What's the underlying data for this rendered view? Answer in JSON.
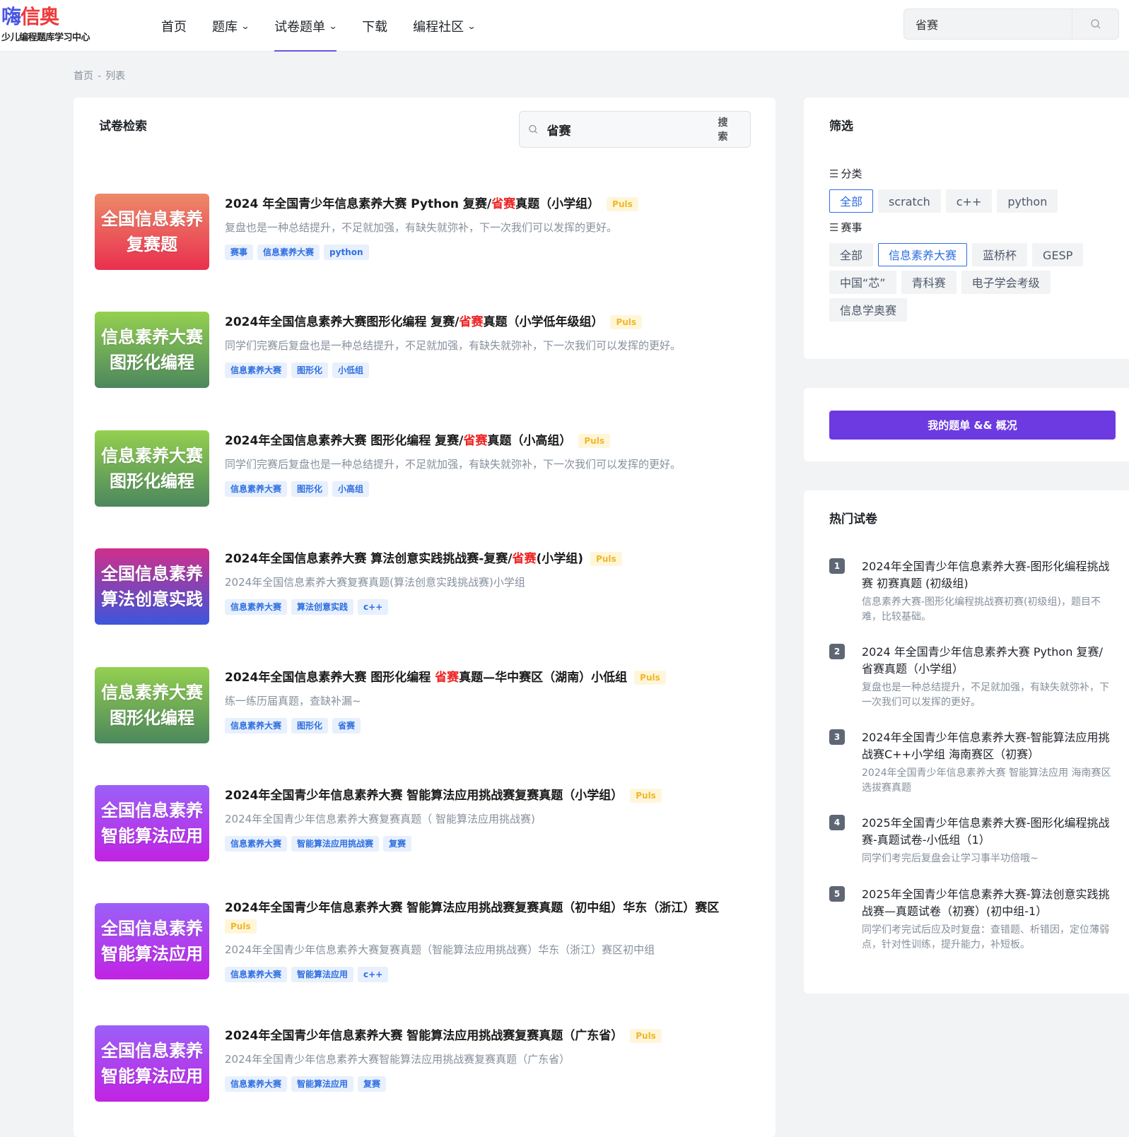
{
  "header": {
    "logo_main_a": "嗨",
    "logo_main_b": "信奥",
    "logo_sub": "少儿编程题库学习中心",
    "nav": [
      {
        "label": "首页"
      },
      {
        "label": "题库"
      },
      {
        "label": "试卷题单"
      },
      {
        "label": "下载"
      },
      {
        "label": "编程社区"
      }
    ],
    "search_value": "省赛"
  },
  "breadcrumb": {
    "home": "首页",
    "sep": "-",
    "current": "列表"
  },
  "main": {
    "title": "试卷检索",
    "search_value": "省赛",
    "search_button": "搜索",
    "items": [
      {
        "cover": [
          "全国信息素养",
          "复赛题"
        ],
        "title_pre": "2024 年全国青少年信息素养大赛 Python 复赛/",
        "title_hl": "省赛",
        "title_post": "真题（小学组）",
        "badge": "Puls",
        "desc": "复盘也是一种总结提升，不足就加强，有缺失就弥补，下一次我们可以发挥的更好。",
        "tags": [
          "赛事",
          "信息素养大赛",
          "python"
        ]
      },
      {
        "cover": [
          "信息素养大赛",
          "图形化编程"
        ],
        "title_pre": "2024年全国信息素养大赛图形化编程 复赛/",
        "title_hl": "省赛",
        "title_post": "真题（小学低年级组）",
        "badge": "Puls",
        "desc": "同学们完赛后复盘也是一种总结提升，不足就加强，有缺失就弥补，下一次我们可以发挥的更好。",
        "tags": [
          "信息素养大赛",
          "图形化",
          "小低组"
        ]
      },
      {
        "cover": [
          "信息素养大赛",
          "图形化编程"
        ],
        "title_pre": "2024年全国信息素养大赛 图形化编程 复赛/",
        "title_hl": "省赛",
        "title_post": "真题（小高组）",
        "badge": "Puls",
        "desc": "同学们完赛后复盘也是一种总结提升，不足就加强，有缺失就弥补，下一次我们可以发挥的更好。",
        "tags": [
          "信息素养大赛",
          "图形化",
          "小高组"
        ]
      },
      {
        "cover": [
          "全国信息素养",
          "算法创意实践"
        ],
        "title_pre": "2024年全国信息素养大赛 算法创意实践挑战赛-复赛/",
        "title_hl": "省赛",
        "title_post": "(小学组)",
        "badge": "Puls",
        "desc": "2024年全国信息素养大赛复赛真题(算法创意实践挑战赛)小学组",
        "tags": [
          "信息素养大赛",
          "算法创意实践",
          "c++"
        ]
      },
      {
        "cover": [
          "信息素养大赛",
          "图形化编程"
        ],
        "title_pre": "2024年全国信息素养大赛 图形化编程 ",
        "title_hl": "省赛",
        "title_post": "真题—华中赛区（湖南）小低组",
        "badge": "Puls",
        "desc": "练一练历届真题，查缺补漏~",
        "tags": [
          "信息素养大赛",
          "图形化",
          "省赛"
        ]
      },
      {
        "cover": [
          "全国信息素养",
          "智能算法应用"
        ],
        "title_pre": "2024年全国青少年信息素养大赛 智能算法应用挑战赛复赛真题（小学组）",
        "title_hl": "",
        "title_post": "",
        "badge": "Puls",
        "desc": "2024年全国青少年信息素养大赛复赛真题（ 智能算法应用挑战赛)",
        "tags": [
          "信息素养大赛",
          "智能算法应用挑战赛",
          "复赛"
        ]
      },
      {
        "cover": [
          "全国信息素养",
          "智能算法应用"
        ],
        "title_pre": "2024年全国青少年信息素养大赛 智能算法应用挑战赛复赛真题（初中组）华东（浙江）赛区",
        "title_hl": "",
        "title_post": "",
        "badge": "Puls",
        "desc": "2024年全国青少年信息素养大赛复赛真题（智能算法应用挑战赛）华东（浙江）赛区初中组",
        "tags": [
          "信息素养大赛",
          "智能算法应用",
          "c++"
        ]
      },
      {
        "cover": [
          "全国信息素养",
          "智能算法应用"
        ],
        "title_pre": "2024年全国青少年信息素养大赛 智能算法应用挑战赛复赛真题（广东省）",
        "title_hl": "",
        "title_post": "",
        "badge": "Puls",
        "desc": "2024年全国青少年信息素养大赛智能算法应用挑战赛复赛真题（广东省）",
        "tags": [
          "信息素养大赛",
          "智能算法应用",
          "复赛"
        ]
      }
    ]
  },
  "filter": {
    "title": "筛选",
    "category_label": "分类",
    "categories": [
      "全部",
      "scratch",
      "c++",
      "python"
    ],
    "category_active": "全部",
    "contest_label": "赛事",
    "contests": [
      "全部",
      "信息素养大赛",
      "蓝桥杯",
      "GESP",
      "中国“芯”",
      "青科赛",
      "电子学会考级",
      "信息学奥赛"
    ],
    "contest_active": "信息素养大赛"
  },
  "mylist": {
    "button": "我的题单 && 概况"
  },
  "hot": {
    "title": "热门试卷",
    "items": [
      {
        "rank": "1",
        "title": "2024年全国青少年信息素养大赛-图形化编程挑战赛 初赛真题 (初级组)",
        "desc": "信息素养大赛-图形化编程挑战赛初赛(初级组)，题目不难，比较基础。"
      },
      {
        "rank": "2",
        "title": "2024 年全国青少年信息素养大赛 Python 复赛/省赛真题（小学组）",
        "desc": "复盘也是一种总结提升，不足就加强，有缺失就弥补，下一次我们可以发挥的更好。"
      },
      {
        "rank": "3",
        "title": "2024年全国青少年信息素养大赛-智能算法应用挑战赛C++小学组 海南赛区（初赛）",
        "desc": "2024年全国青少年信息素养大赛 智能算法应用 海南赛区选拔赛真题"
      },
      {
        "rank": "4",
        "title": "2025年全国青少年信息素养大赛-图形化编程挑战赛-真题试卷-小低组（1）",
        "desc": "同学们考完后复盘会让学习事半功倍哦~"
      },
      {
        "rank": "5",
        "title": "2025年全国青少年信息素养大赛-算法创意实践挑战赛—真题试卷（初赛）(初中组-1）",
        "desc": "同学们考完试后应及时复盘：查错题、析错因，定位薄弱点，针对性训练，提升能力，补短板。"
      }
    ]
  }
}
